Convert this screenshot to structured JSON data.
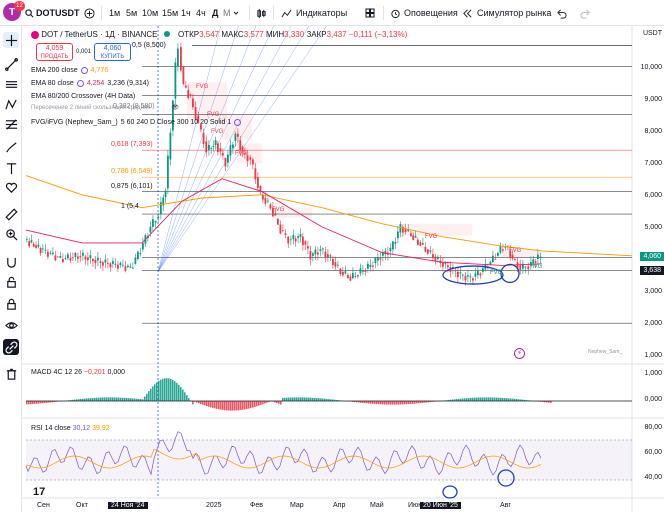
{
  "header": {
    "symbol": "DOTUSDT",
    "avatar_letter": "T",
    "notif_count": "12",
    "intervals": [
      "1м",
      "5м",
      "10м",
      "15м",
      "1ч",
      "4ч",
      "Д",
      "М"
    ],
    "indicators_label": "Индикаторы",
    "alerts_label": "Оповещения",
    "replay_label": "Симулятор рынка"
  },
  "instrument": {
    "title": "DOT / TetherUS · 1Д · BINANCE",
    "open_label": "ОТКР",
    "open": "3,547",
    "high_label": "МАКС",
    "high": "3,577",
    "low_label": "МИН",
    "low": "3,330",
    "close_label": "ЗАКР",
    "close": "3,437",
    "change": "−0,111 (−3,13%)"
  },
  "trade": {
    "sell_price": "4,059",
    "sell_label": "ПРОДАТЬ",
    "spread": "0,001",
    "buy_price": "4,060",
    "buy_label": "КУПИТЬ"
  },
  "legend": {
    "ema200_name": "EMA 200 close",
    "ema200_val": "4,776",
    "ema80_name": "EMA 80 close",
    "ema80_val": "4,254",
    "ema80_extra": "3,236 (9,314)",
    "cross_name": "EMA 80/200 Crossover (4H Data)",
    "cross_sub": "Пересечение 2 линий скользящих средних",
    "fvg_name": "FVG/iFVG (Nephew_Sam_)",
    "fvg_params": "5 60 240 D Close 300 10 20 Solid 1"
  },
  "fib": [
    {
      "label": "0,5 (8,500)",
      "color": "#131722"
    },
    {
      "label": "0,382 (8,580)",
      "color": "#787b86"
    },
    {
      "label": "0,618 (7,393)",
      "color": "#f23645"
    },
    {
      "label": "0,786 (6,549)",
      "color": "#ff9800"
    },
    {
      "label": "0,875 (6,101)",
      "color": "#131722"
    },
    {
      "label": "1 (5,4",
      "color": "#131722"
    }
  ],
  "fvg_tags": [
    "FVG",
    "FVG",
    "FVG",
    "FVG",
    "FVG",
    "FVG",
    "FVG",
    "FVG",
    "FVG"
  ],
  "price_axis": {
    "currency": "USDT",
    "ticks": [
      "10,000",
      "9,000",
      "8,000",
      "7,000",
      "6,000",
      "5,000",
      "4,000",
      "3,000",
      "2,000",
      "1,000"
    ],
    "last_price": "4,060",
    "line_price": "3,638"
  },
  "macd": {
    "name": "MACD 4C 12 26",
    "val1": "−0,201",
    "val2": "0,000",
    "ticks": [
      "1,000",
      "0,000"
    ]
  },
  "rsi": {
    "name": "RSI 14 close",
    "val1": "30,12",
    "val2": "39,92",
    "ticks": [
      "80,00",
      "60,00",
      "40,00"
    ]
  },
  "watermark": "Nephew_Sam_",
  "dates": [
    "Сен",
    "Окт",
    "24 Ноя '24",
    "2025",
    "Фев",
    "Мар",
    "Апр",
    "Май",
    "Июн",
    "20 Июн '25",
    "Авг"
  ],
  "colors": {
    "up": "#089981",
    "down": "#f23645",
    "ema200": "#ff9800",
    "ema80": "#e91e63",
    "rsi": "#7e57c2",
    "accent": "#2962ff"
  }
}
